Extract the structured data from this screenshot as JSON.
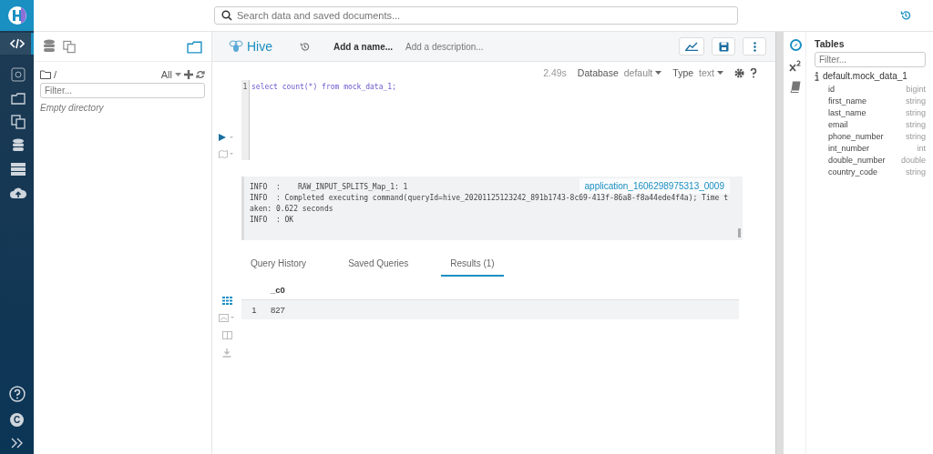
{
  "top_bar": {
    "search_placeholder": "Search data and saved documents..."
  },
  "nav": {
    "items": [
      {
        "selected": true
      },
      {
        "selected": false
      },
      {
        "selected": false
      },
      {
        "selected": false
      },
      {
        "selected": false
      },
      {
        "selected": false
      },
      {
        "selected": false
      }
    ],
    "user_initial": "C"
  },
  "left_panel": {
    "path": "/",
    "filter_label": "All",
    "filter_placeholder": "Filter...",
    "empty_text": "Empty directory"
  },
  "editor": {
    "title": "Hive",
    "name_placeholder": "Add a name...",
    "description_placeholder": "Add a description...",
    "elapsed": "2.49s",
    "database_label": "Database",
    "database_value": "default",
    "type_label": "Type",
    "type_value": "text",
    "line_number": "1",
    "query": "select count(*) from mock_data_1;"
  },
  "log": {
    "lines": [
      "INFO  :    RAW_INPUT_SPLITS_Map_1: 1",
      "INFO  : Completed executing command(queryId=hive_20201125123242_891b1743-8c69-413f-86a8-f8a44ede4f4a); Time taken: 0.622 seconds",
      "INFO  : OK"
    ],
    "application_link": "application_1606298975313_0009"
  },
  "result_tabs": [
    {
      "label": "Query History",
      "selected": false
    },
    {
      "label": "Saved Queries",
      "selected": false
    },
    {
      "label": "Results (1)",
      "selected": true
    }
  ],
  "results": {
    "columns": [
      "_c0"
    ],
    "rows": [
      {
        "index": "1",
        "cells": [
          "827"
        ]
      }
    ]
  },
  "right_panel": {
    "title": "Tables",
    "filter_placeholder": "Filter...",
    "table": "default.mock_data_1",
    "columns": [
      {
        "name": "id",
        "type": "bigint"
      },
      {
        "name": "first_name",
        "type": "string"
      },
      {
        "name": "last_name",
        "type": "string"
      },
      {
        "name": "email",
        "type": "string"
      },
      {
        "name": "phone_number",
        "type": "string"
      },
      {
        "name": "int_number",
        "type": "int"
      },
      {
        "name": "double_number",
        "type": "double"
      },
      {
        "name": "country_code",
        "type": "string"
      }
    ]
  }
}
